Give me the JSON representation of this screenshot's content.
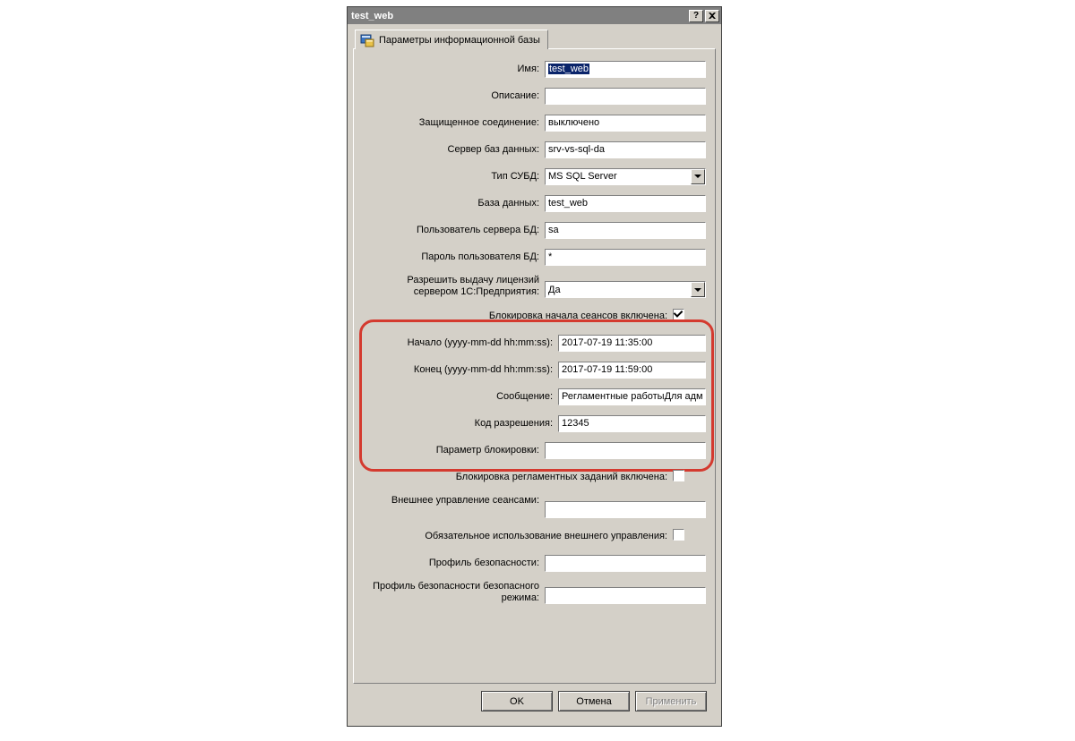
{
  "window": {
    "title": "test_web"
  },
  "tab": {
    "label": "Параметры информационной базы"
  },
  "fields": {
    "name_label": "Имя:",
    "name_value": "test_web",
    "desc_label": "Описание:",
    "desc_value": "",
    "secure_label": "Защищенное соединение:",
    "secure_value": "выключено",
    "dbserver_label": "Сервер баз данных:",
    "dbserver_value": "srv-vs-sql-da",
    "dbms_label": "Тип СУБД:",
    "dbms_value": "MS SQL Server",
    "db_label": "База данных:",
    "db_value": "test_web",
    "dbuser_label": "Пользователь сервера БД:",
    "dbuser_value": "sa",
    "dbpwd_label": "Пароль пользователя БД:",
    "dbpwd_value": "*",
    "lic_label": "Разрешить выдачу лицензий сервером 1С:Предприятия:",
    "lic_value": "Да",
    "block_on_label": "Блокировка начала сеансов включена:",
    "start_label": "Начало (yyyy-mm-dd hh:mm:ss):",
    "start_value": "2017-07-19 11:35:00",
    "end_label": "Конец (yyyy-mm-dd hh:mm:ss):",
    "end_value": "2017-07-19 11:59:00",
    "msg_label": "Сообщение:",
    "msg_value": "Регламентные работыДля адм",
    "code_label": "Код разрешения:",
    "code_value": "12345",
    "param_label": "Параметр блокировки:",
    "param_value": "",
    "jobs_block_label": "Блокировка регламентных заданий включена:",
    "ext_mgmt_label": "Внешнее управление сеансами:",
    "ext_mgmt_value": "",
    "ext_req_label": "Обязательное использование внешнего управления:",
    "profile_label": "Профиль безопасности:",
    "profile_value": "",
    "safe_profile_label": "Профиль безопасности безопасного режима:",
    "safe_profile_value": ""
  },
  "buttons": {
    "ok": "OK",
    "cancel": "Отмена",
    "apply": "Применить"
  }
}
